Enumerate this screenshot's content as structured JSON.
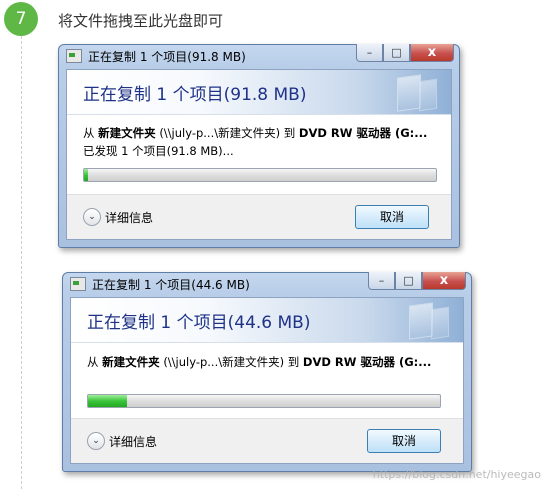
{
  "step": {
    "number": "7",
    "title": "将文件拖拽至此光盘即可"
  },
  "dialog1": {
    "window_title": "正在复制 1 个项目(91.8 MB)",
    "header": "正在复制 1 个项目(91.8 MB)",
    "from_label": "从",
    "from_source": "新建文件夹",
    "from_path": "(\\\\july-p...\\新建文件夹)",
    "to_label": "到",
    "to_dest": "DVD RW 驱动器 (G:...",
    "found": "已发现 1 个项目(91.8 MB)...",
    "progress": 0.01,
    "details": "详细信息",
    "cancel": "取消"
  },
  "dialog2": {
    "window_title": "正在复制 1 个项目(44.6 MB)",
    "header": "正在复制 1 个项目(44.6 MB)",
    "from_label": "从",
    "from_source": "新建文件夹",
    "from_path": "(\\\\july-p...\\新建文件夹)",
    "to_label": "到",
    "to_dest": "DVD RW 驱动器 (G:...",
    "progress": 0.11,
    "details": "详细信息",
    "cancel": "取消"
  },
  "window_buttons": {
    "minimize": "–",
    "maximize": "□",
    "close": "x"
  },
  "icons": {
    "app": "copy-icon",
    "chevron": "chevron-down-icon"
  },
  "colors": {
    "step_badge": "#5fb846",
    "progress": "#21a921",
    "header_text": "#1e3287"
  },
  "watermark": "https://blog.csdn.net/hiyeegao"
}
